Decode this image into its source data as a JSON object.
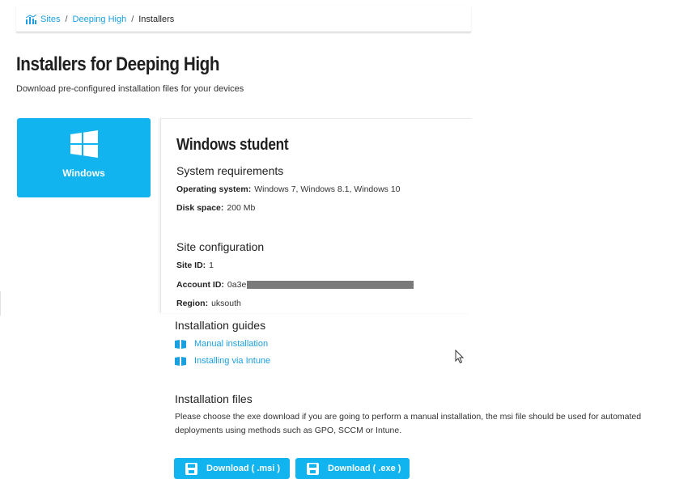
{
  "breadcrumb": {
    "items": [
      "Sites",
      "Deeping High"
    ],
    "separator": "/",
    "current": "Installers"
  },
  "page": {
    "title": "Installers for Deeping High",
    "subtitle": "Download pre-configured installation files for your devices"
  },
  "os_tiles": [
    {
      "label": "Windows",
      "icon": "windows-logo-icon",
      "selected": true
    }
  ],
  "panel": {
    "title": "Windows student",
    "requirements": {
      "heading": "System requirements",
      "os_label": "Operating system:",
      "os_value": "Windows 7, Windows 8.1, Windows 10",
      "disk_label": "Disk space:",
      "disk_value": "200 Mb"
    },
    "site_config": {
      "heading": "Site configuration",
      "site_id_label": "Site ID:",
      "site_id_value": "1",
      "account_id_label": "Account ID:",
      "account_id_value": "0a3e",
      "region_label": "Region:",
      "region_value": "uksouth"
    }
  },
  "guides": {
    "heading": "Installation guides",
    "items": [
      "Manual installation",
      "Installing via Intune"
    ]
  },
  "files": {
    "heading": "Installation files",
    "description": "Please choose the exe download if you are going to perform a manual installation, the msi file should be used for automated deployments using methods such as GPO, SCCM or Intune.",
    "buttons": [
      "Download ( .msi )",
      "Download ( .exe )"
    ]
  },
  "colors": {
    "accent": "#12b4ef",
    "link": "#1a9fe0"
  }
}
